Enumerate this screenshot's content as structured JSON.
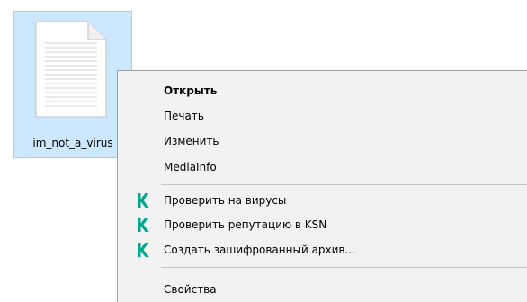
{
  "desktop": {
    "file": {
      "name": "im_not_a_virus",
      "icon": "text-document-icon"
    }
  },
  "context_menu": {
    "items": [
      {
        "label": "Открыть",
        "bold": true
      },
      {
        "label": "Печать"
      },
      {
        "label": "Изменить"
      },
      {
        "label": "MediaInfo"
      },
      {
        "label": "Проверить на вирусы",
        "icon": "kaspersky-k-icon"
      },
      {
        "label": "Проверить репутацию в KSN",
        "icon": "kaspersky-k-icon"
      },
      {
        "label": "Создать зашифрованный архив...",
        "icon": "kaspersky-k-icon"
      },
      {
        "label": "Свойства"
      }
    ]
  },
  "colors": {
    "selection_bg": "#cce8ff",
    "selection_border": "#99d1ff",
    "menu_bg": "#f2f2f2",
    "kaspersky_green": "#00a88e"
  }
}
